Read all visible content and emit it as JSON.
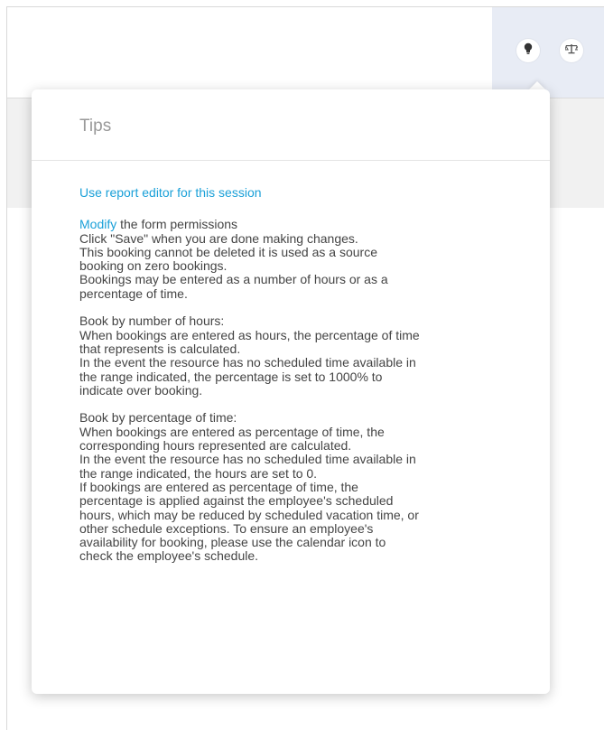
{
  "toolbar": {
    "tips_icon": "lightbulb-icon",
    "scale_icon": "scale-icon"
  },
  "tips": {
    "title": "Tips",
    "report_link": "Use report editor for this session",
    "modify_link": "Modify",
    "modify_rest": " the form permissions",
    "lines_block1": [
      "Click \"Save\" when you are done making changes.",
      "This booking cannot be deleted it is used as a source",
      "booking on zero bookings.",
      "Bookings may be entered as a number of hours or as a",
      "percentage of time."
    ],
    "lines_block2": [
      "Book by number of hours:",
      "When bookings are entered as hours, the percentage of time",
      "that represents is calculated.",
      "In the event the resource has no scheduled time available in",
      "the range indicated, the percentage is set to 1000% to",
      "indicate over booking."
    ],
    "lines_block3": [
      "Book by percentage of time:",
      "When bookings are entered as percentage of time, the",
      "corresponding hours represented are calculated.",
      "In the event the resource has no scheduled time available in",
      "the range indicated, the hours are set to 0.",
      "If bookings are entered as percentage of time, the",
      "percentage is applied against the employee's scheduled",
      "hours, which may be reduced by scheduled vacation time, or",
      "other schedule exceptions. To ensure an employee's",
      "availability for booking, please use the calendar icon to",
      "check the employee's schedule."
    ]
  },
  "colors": {
    "link": "#1aa0d8",
    "text": "#444444",
    "title": "#999999",
    "topbar_right": "#e8ecf5"
  }
}
